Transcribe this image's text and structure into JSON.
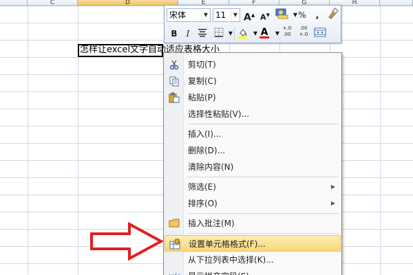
{
  "spreadsheet": {
    "columns": [
      "C",
      "D",
      "E",
      "F",
      "G",
      "H"
    ],
    "selected_column": "D",
    "cell_text": "怎样让excel文字自动适应表格大小"
  },
  "mini_toolbar": {
    "font_name": "宋体",
    "font_size": "11",
    "grow_font": "A",
    "shrink_font": "A",
    "percent": "%",
    "comma": ",",
    "bold": "B",
    "italic": "I",
    "font_color_letter": "A",
    "increase_decimal": "+.0\n.00",
    "decrease_decimal": ".00\n+.0"
  },
  "context_menu": {
    "items": [
      {
        "label": "剪切(T)",
        "icon": "scissors-icon"
      },
      {
        "label": "复制(C)",
        "icon": "copy-icon"
      },
      {
        "label": "粘贴(P)",
        "icon": "paste-icon"
      },
      {
        "label": "选择性粘贴(V)...",
        "icon": ""
      },
      {
        "label": "插入(I)...",
        "icon": ""
      },
      {
        "label": "删除(D)...",
        "icon": ""
      },
      {
        "label": "清除内容(N)",
        "icon": ""
      },
      {
        "label": "筛选(E)",
        "icon": "",
        "submenu": true
      },
      {
        "label": "排序(O)",
        "icon": "",
        "submenu": true
      },
      {
        "label": "插入批注(M)",
        "icon": "comment-icon"
      },
      {
        "label": "设置单元格格式(F)...",
        "icon": "format-cells-icon",
        "highlighted": true
      },
      {
        "label": "从下拉列表中选择(K)...",
        "icon": ""
      },
      {
        "label": "显示拼音字段(S)",
        "icon": "phonetic-icon"
      }
    ]
  },
  "colors": {
    "highlight": "#fbd676",
    "arrow_outline": "#e02020",
    "selected_column_header": "#f1c15f"
  }
}
